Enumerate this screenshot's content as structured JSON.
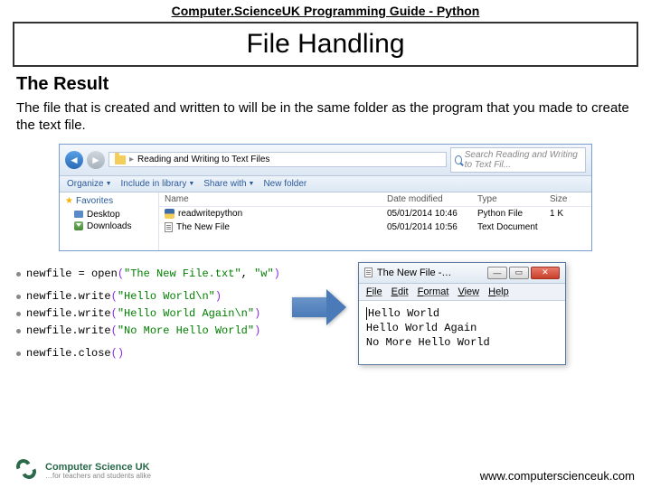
{
  "header": {
    "label": "Computer.ScienceUK Programming Guide - Python"
  },
  "title": "File Handling",
  "subhead": "The Result",
  "body": "The file that is created and written to will be in the same folder as the program that you made to create the text file.",
  "explorer": {
    "breadcrumb": "Reading and Writing to Text Files",
    "searchPlaceholder": "Search Reading and Writing to Text Fil...",
    "toolbar": {
      "organize": "Organize",
      "include": "Include in library",
      "share": "Share with",
      "newfolder": "New folder"
    },
    "sidebar": {
      "favorites": "Favorites",
      "desktop": "Desktop",
      "downloads": "Downloads"
    },
    "columns": {
      "name": "Name",
      "date": "Date modified",
      "type": "Type",
      "size": "Size"
    },
    "rows": [
      {
        "name": "readwritepython",
        "date": "05/01/2014 10:46",
        "type": "Python File",
        "size": "1 K"
      },
      {
        "name": "The New File",
        "date": "05/01/2014 10:56",
        "type": "Text Document",
        "size": ""
      }
    ]
  },
  "code": {
    "l1a": "newfile ",
    "l1b": "= ",
    "l1c": "open",
    "l1d": "(",
    "l1e": "\"The New File.txt\"",
    "l1f": ", ",
    "l1g": "\"w\"",
    "l1h": ")",
    "l2a": "newfile.write",
    "l2b": "(",
    "l2c": "\"Hello World\\n\"",
    "l2d": ")",
    "l3a": "newfile.write",
    "l3b": "(",
    "l3c": "\"Hello World Again\\n\"",
    "l3d": ")",
    "l4a": "newfile.write",
    "l4b": "(",
    "l4c": "\"No More Hello World\"",
    "l4d": ")",
    "l5a": "newfile.close",
    "l5b": "()"
  },
  "notepad": {
    "title": "The New File -…",
    "menu": {
      "file": "File",
      "edit": "Edit",
      "format": "Format",
      "view": "View",
      "help": "Help"
    },
    "content": "Hello World\nHello World Again\nNo More Hello World"
  },
  "footer": {
    "logoName": "Computer Science UK",
    "logoTag": "…for teachers and students alike",
    "url": "www.computerscienceuk.com"
  }
}
